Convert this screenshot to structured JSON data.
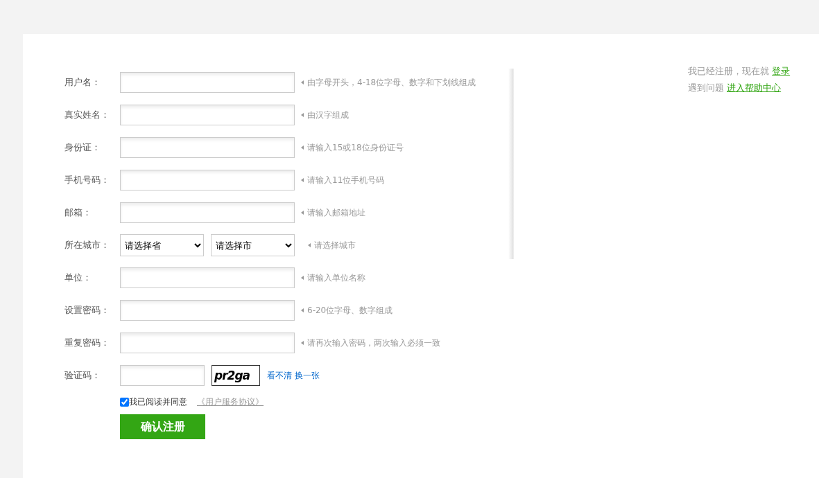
{
  "form": {
    "rows": [
      {
        "kind": "text",
        "label": "用户名：",
        "hint": "由字母开头，4-18位字母、数字和下划线组成"
      },
      {
        "kind": "text",
        "label": "真实姓名：",
        "hint": "由汉字组成"
      },
      {
        "kind": "text",
        "label": "身份证：",
        "hint": "请输入15或18位身份证号"
      },
      {
        "kind": "text",
        "label": "手机号码：",
        "hint": "请输入11位手机号码"
      },
      {
        "kind": "text",
        "label": "邮箱：",
        "hint": "请输入邮箱地址"
      },
      {
        "kind": "select",
        "label": "所在城市：",
        "selects": [
          "请选择省",
          "请选择市"
        ],
        "hint": "请选择城市"
      },
      {
        "kind": "text",
        "label": "单位：",
        "hint": "请输入单位名称"
      },
      {
        "kind": "text",
        "label": "设置密码：",
        "hint": "6-20位字母、数字组成"
      },
      {
        "kind": "text",
        "label": "重复密码：",
        "hint": "请再次输入密码，两次输入必须一致"
      },
      {
        "kind": "captcha",
        "label": "验证码：",
        "captcha": "pr2ga",
        "refresh_link": "看不清 换一张"
      }
    ],
    "agree": {
      "checked": true,
      "label": "我已阅读并同意",
      "link": "《用户服务协议》"
    },
    "submit": "确认注册"
  },
  "side": {
    "registered_text": "我已经注册，现在就",
    "login_link": "登录",
    "help_text": "遇到问题",
    "help_link": "进入帮助中心"
  }
}
